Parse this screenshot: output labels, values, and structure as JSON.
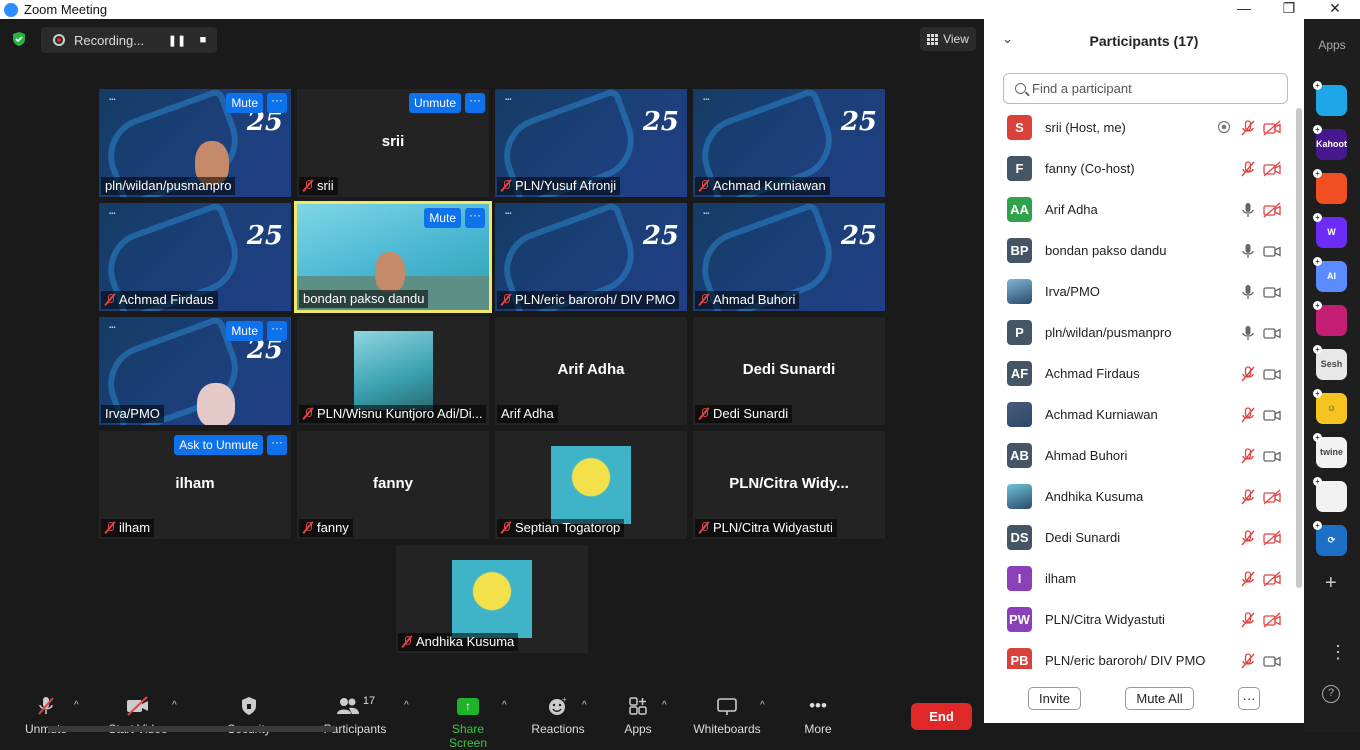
{
  "window": {
    "title": "Zoom Meeting",
    "controls": [
      "—",
      "❐",
      "✕"
    ]
  },
  "recording": {
    "label": "Recording..."
  },
  "view": {
    "label": "View"
  },
  "tiles": [
    {
      "name": "pln/wildan/pusmanpro",
      "muted": false,
      "button": "Mute"
    },
    {
      "name": "srii",
      "center": "srii",
      "muted": true,
      "button": "Unmute"
    },
    {
      "name": "PLN/Yusuf Afronji",
      "muted": true
    },
    {
      "name": "Achmad Kurniawan",
      "muted": true
    },
    {
      "name": "Achmad Firdaus",
      "muted": true
    },
    {
      "name": "bondan pakso dandu",
      "muted": false,
      "button": "Mute"
    },
    {
      "name": "PLN/eric baroroh/ DIV PMO",
      "muted": true
    },
    {
      "name": "Ahmad Buhori",
      "muted": true
    },
    {
      "name": "Irva/PMO",
      "muted": false,
      "button": "Mute"
    },
    {
      "name": "PLN/Wisnu Kuntjoro Adi/Di...",
      "muted": true
    },
    {
      "name": "Arif Adha",
      "center": "Arif Adha",
      "muted": false
    },
    {
      "name": "Dedi Sunardi",
      "center": "Dedi Sunardi",
      "muted": true
    },
    {
      "name": "ilham",
      "center": "ilham",
      "muted": true,
      "button": "Ask to Unmute"
    },
    {
      "name": "fanny",
      "center": "fanny",
      "muted": true
    },
    {
      "name": "Septian Togatorop",
      "muted": true
    },
    {
      "name": "PLN/Citra Widyastuti",
      "center": "PLN/Citra  Widy...",
      "muted": true
    },
    {
      "name": "Andhika Kusuma",
      "muted": true
    }
  ],
  "tile_more": "···",
  "toolbar": {
    "unmute": "Unmute",
    "start_video": "Start Video",
    "security": "Security",
    "participants": "Participants",
    "participants_count": "17",
    "share_screen": "Share Screen",
    "reactions": "Reactions",
    "apps": "Apps",
    "whiteboards": "Whiteboards",
    "more": "More",
    "end": "End"
  },
  "panel": {
    "title": "Participants (17)",
    "search_placeholder": "Find a participant",
    "participants": [
      {
        "initials": "S",
        "name": "srii (Host, me)",
        "color": "#d9413a",
        "mic": "off",
        "video": "off",
        "recording": true
      },
      {
        "initials": "F",
        "name": "fanny (Co-host)",
        "color": "#445566",
        "mic": "off",
        "video": "off"
      },
      {
        "initials": "AA",
        "name": "Arif Adha",
        "color": "#2fa24a",
        "mic": "on",
        "video": "off"
      },
      {
        "initials": "BP",
        "name": "bondan pakso dandu",
        "color": "#445566",
        "mic": "on",
        "video": "on"
      },
      {
        "initials": "",
        "name": "Irva/PMO",
        "color": "#7fb6d6",
        "mic": "on",
        "video": "on"
      },
      {
        "initials": "P",
        "name": "pln/wildan/pusmanpro",
        "color": "#445566",
        "mic": "on",
        "video": "on"
      },
      {
        "initials": "AF",
        "name": "Achmad Firdaus",
        "color": "#445566",
        "mic": "off",
        "video": "on"
      },
      {
        "initials": "",
        "name": "Achmad Kurniawan",
        "color": "#4a5a7a",
        "mic": "off",
        "video": "on"
      },
      {
        "initials": "AB",
        "name": "Ahmad Buhori",
        "color": "#445566",
        "mic": "off",
        "video": "on"
      },
      {
        "initials": "",
        "name": "Andhika Kusuma",
        "color": "#6fc2d8",
        "mic": "off",
        "video": "off"
      },
      {
        "initials": "DS",
        "name": "Dedi Sunardi",
        "color": "#445566",
        "mic": "off",
        "video": "off"
      },
      {
        "initials": "I",
        "name": "ilham",
        "color": "#8b3fb8",
        "mic": "off",
        "video": "off"
      },
      {
        "initials": "PW",
        "name": "PLN/Citra Widyastuti",
        "color": "#8b3fb8",
        "mic": "off",
        "video": "off"
      },
      {
        "initials": "PB",
        "name": "PLN/eric baroroh/ DIV PMO",
        "color": "#d9413a",
        "mic": "off",
        "video": "on"
      }
    ],
    "invite": "Invite",
    "mute_all": "Mute All",
    "more": "···"
  },
  "apps_bar": {
    "label": "Apps",
    "apps": [
      {
        "name": "blue-app",
        "text": "",
        "color": "#1ea7e8"
      },
      {
        "name": "kahoot",
        "text": "Kahoot!",
        "color": "#46178f"
      },
      {
        "name": "orange-app",
        "text": "",
        "color": "#f04e23"
      },
      {
        "name": "wooclap",
        "text": "W",
        "color": "#6c2cf5"
      },
      {
        "name": "ai-app",
        "text": "AI",
        "color": "#5a8cff"
      },
      {
        "name": "pink-app",
        "text": "",
        "color": "#c21e73"
      },
      {
        "name": "sesh",
        "text": "Sesh",
        "color": "#e8e8e8"
      },
      {
        "name": "emoji-app",
        "text": "☺",
        "color": "#f7c41f"
      },
      {
        "name": "twine",
        "text": "twine",
        "color": "#f2f2f2"
      },
      {
        "name": "grid-app",
        "text": "",
        "color": "#f2f2f2"
      },
      {
        "name": "sync-app",
        "text": "⟳",
        "color": "#1d6fc5"
      }
    ]
  }
}
